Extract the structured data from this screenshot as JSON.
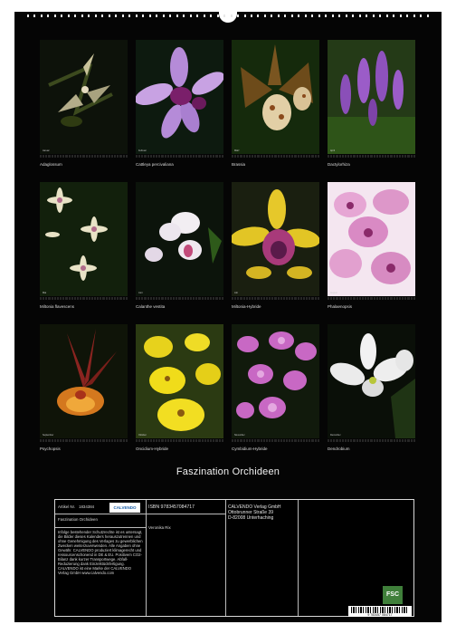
{
  "title": "Faszination Orchideen",
  "months": [
    {
      "month": "Januar",
      "caption": "Adaglossum"
    },
    {
      "month": "Februar",
      "caption": "Cattleya percivaliana"
    },
    {
      "month": "März",
      "caption": "Brassia"
    },
    {
      "month": "April",
      "caption": "Dactylorhiza"
    },
    {
      "month": "Mai",
      "caption": "Miltonia flavescens"
    },
    {
      "month": "Juni",
      "caption": "Calanthe vestita"
    },
    {
      "month": "Juli",
      "caption": "Miltonia-Hybride"
    },
    {
      "month": "August",
      "caption": "Phalaenopsis"
    },
    {
      "month": "September",
      "caption": "Psychopsis"
    },
    {
      "month": "Oktober",
      "caption": "Oncidium-Hybride"
    },
    {
      "month": "November",
      "caption": "Cymbidium-Hybride"
    },
    {
      "month": "Dezember",
      "caption": "Dendrobium"
    }
  ],
  "info": {
    "article_label": "Artikel Nr.",
    "article_no": "1834384",
    "product_title": "Faszination Orchideen",
    "calvendo_logo": "CALVENDO",
    "isbn": "ISBN 9783457084717",
    "author": "Veronika Rix",
    "publisher_lines": [
      "CALVENDO Verlag GmbH",
      "Ottobrunner Straße 39",
      "D-82008 Unterhaching"
    ],
    "legal_text": "Infolge bestehender Schutzrechte ist es untersagt, die Bilder dieses Kalenders herauszutrennen und ohne Genehmigung des Verlages zu gewerblichen Zwecken weiterzuverwenden. Alle Angaben ohne Gewähr. CALVENDO produziert klimagerecht und ressourcenschonend in DE & EU. Positivem CO2-Bilanz dank kurzer Transportwege. Abfall-Reduzierung dank Einzelstückfertigung. CALVENDO ist eine Marke der CALVENDO Verlag GmbH www.calvendo.com",
    "fsc_label": "FSC",
    "barcode_number": "9 783457 084717"
  },
  "colors": {
    "background": "#050505",
    "border": "#d8d8d8",
    "fsc": "#3f7f3a",
    "calvendo_blue": "#1a5fa8"
  }
}
